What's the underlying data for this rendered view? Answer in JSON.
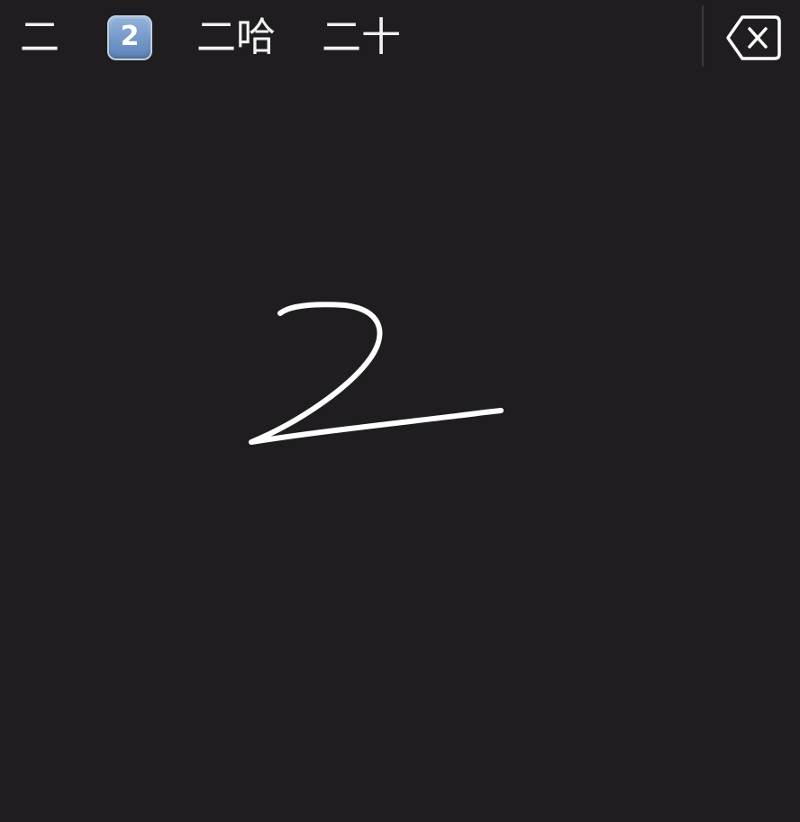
{
  "candidates": {
    "item1": "二",
    "item2_emoji_digit": "2",
    "item3": "二哈",
    "item4": "二十"
  },
  "icons": {
    "keycap": "keycap-digit-two-emoji",
    "delete": "delete-backspace-icon"
  },
  "colors": {
    "background": "#1f1d20",
    "ink": "#ffffff",
    "divider": "#3a383c"
  }
}
